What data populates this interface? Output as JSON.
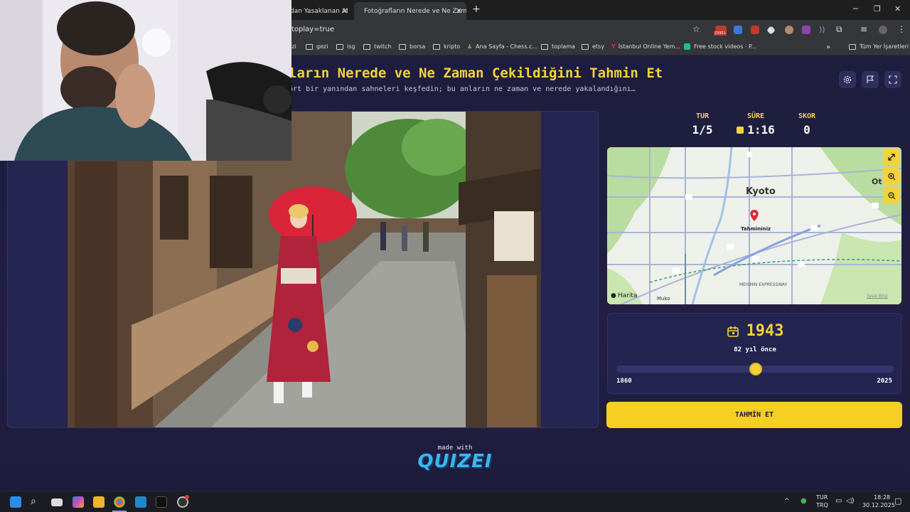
{
  "browser": {
    "tabs": [
      {
        "title": "dan Yasaklanan Al"
      },
      {
        "title": "Fotoğrafların Nerede ve Ne Zam",
        "active": true
      }
    ],
    "url": "toplay=true",
    "ext_badge": "23951",
    "bookmarks": [
      "izi",
      "gezi",
      "isg",
      "twitch",
      "borsa",
      "kripto",
      "Ana Sayfa - Chess.c...",
      "toplama",
      "etsy",
      "İstanbul Online Yem...",
      "Free stock videos · P...",
      "Tüm Yer İşaretleri"
    ]
  },
  "header": {
    "title": "ların Nerede ve Ne Zaman Çekildiğini Tahmin Et",
    "subtitle": "ört bir yanından sahneleri keşfedin; bu anların ne zaman ve nerede yakalandığını…"
  },
  "stats": {
    "round_label": "TUR",
    "round_value": "1/5",
    "time_label": "SÜRE",
    "time_value": "1:16",
    "score_label": "SKOR",
    "score_value": "0"
  },
  "map": {
    "city": "Kyoto",
    "city2": "Ot",
    "marker_label": "Tahmininiz",
    "attribution": "Harita",
    "place_muko": "Muko",
    "expressway": "MEISHIN EXPRESSWAY",
    "legal": "Yasal Bilgi",
    "route_labels": [
      "367",
      "162",
      "182",
      "161",
      "143",
      "171",
      "118",
      "201",
      "117",
      "1",
      "11"
    ]
  },
  "year_guess": {
    "year": "1943",
    "years_ago": "82 yıl önce",
    "min": "1860",
    "max": "2025",
    "fraction": 0.503
  },
  "guess_button": "TAHMİN ET",
  "footer": {
    "made_with": "made with",
    "logo": "QUIZEI"
  },
  "taskbar": {
    "lang_top": "TUR",
    "lang_bottom": "TRQ",
    "time": "18:28",
    "date": "30.12.2025"
  },
  "colors": {
    "accent": "#f5d23b",
    "background": "#1d1d3d",
    "panel": "#242450"
  }
}
